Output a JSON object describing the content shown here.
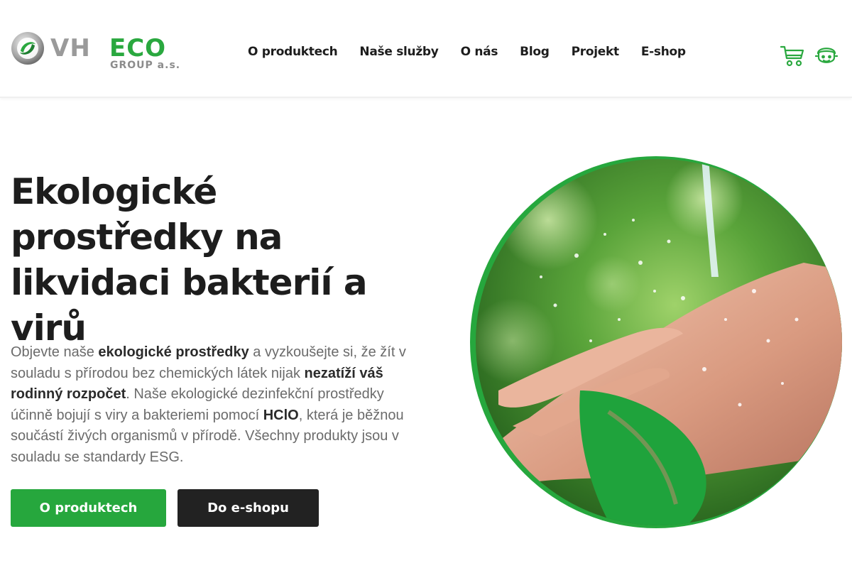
{
  "header": {
    "logo": {
      "text_vh": "VH",
      "text_eco": "ECO",
      "text_group": "GROUP a.s."
    },
    "nav": [
      {
        "label": "O produktech"
      },
      {
        "label": "Naše služby"
      },
      {
        "label": "O nás"
      },
      {
        "label": "Blog"
      },
      {
        "label": "Projekt"
      },
      {
        "label": "E-shop"
      }
    ],
    "icons": {
      "cart": "shopping-cart-icon",
      "user": "user-account-icon"
    }
  },
  "hero": {
    "title": "Ekologické prostředky na likvidaci bakterií a virů",
    "text": [
      {
        "t": "Objevte naše ",
        "bold": false
      },
      {
        "t": "ekologické prostředky",
        "bold": true
      },
      {
        "t": " a vyzkoušejte si, že žít v souladu s přírodou bez chemických látek nijak ",
        "bold": false
      },
      {
        "t": "nezatíží váš rodinný rozpočet",
        "bold": true
      },
      {
        "t": ". Naše ekologické dezinfekční prostředky účinně bojují s viry a bakteriemi pomocí ",
        "bold": false
      },
      {
        "t": "HClO",
        "bold": true
      },
      {
        "t": ", která je běžnou součástí živých organismů v přírodě. Všechny produkty jsou v souladu se standardy ESG.",
        "bold": false
      }
    ],
    "buttons": {
      "primary": "O produktech",
      "secondary": "Do e-shopu"
    },
    "image": {
      "subject": "hands-washing-water-photo",
      "badge_icon": "green-leaf-icon"
    }
  },
  "colors": {
    "brand_green": "#26a73d",
    "dark": "#222222",
    "text_gray": "#6b6b6b"
  }
}
